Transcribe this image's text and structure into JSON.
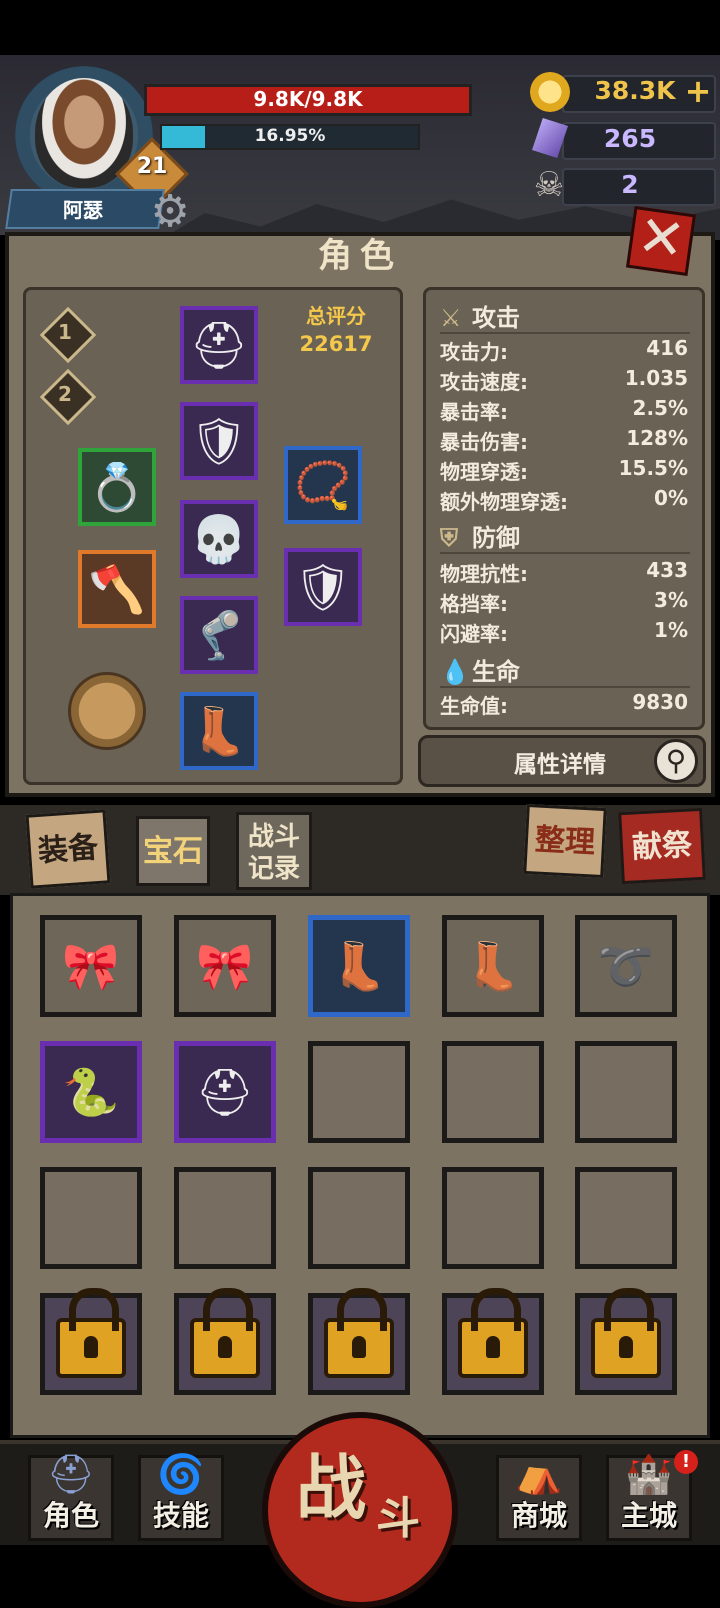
{
  "player": {
    "name": "阿瑟",
    "level": "21",
    "hp_text": "9.8K/9.8K",
    "exp_text": "16.95%",
    "exp_fraction": 0.1695
  },
  "currency": {
    "gold": "38.3K",
    "gold_plus": "+",
    "gems": "265",
    "souls": "2"
  },
  "panel": {
    "title": "角色",
    "close_glyph": "✕"
  },
  "equipment": {
    "score_label": "总评分",
    "score_value": "22617",
    "presets": [
      "1",
      "2"
    ],
    "slots": [
      {
        "name": "helmet",
        "rarity": "purple",
        "icon": "helmet-icon"
      },
      {
        "name": "chest-armor",
        "rarity": "purple",
        "icon": "armor-icon"
      },
      {
        "name": "belt",
        "rarity": "purple",
        "icon": "skull-belt-icon"
      },
      {
        "name": "leg-armor",
        "rarity": "purple",
        "icon": "greaves-icon"
      },
      {
        "name": "boots",
        "rarity": "blue",
        "icon": "boots-icon"
      },
      {
        "name": "ring",
        "rarity": "green",
        "icon": "ring-icon"
      },
      {
        "name": "weapon",
        "rarity": "orange",
        "icon": "axe-icon"
      },
      {
        "name": "necklace",
        "rarity": "blue",
        "icon": "necklace-icon"
      },
      {
        "name": "offhand",
        "rarity": "purple",
        "icon": "shield-icon"
      }
    ]
  },
  "stats": {
    "attack": {
      "title": "攻击",
      "rows": [
        {
          "label": "攻击力:",
          "value": "416"
        },
        {
          "label": "攻击速度:",
          "value": "1.035"
        },
        {
          "label": "暴击率:",
          "value": "2.5%"
        },
        {
          "label": "暴击伤害:",
          "value": "128%"
        },
        {
          "label": "物理穿透:",
          "value": "15.5%"
        },
        {
          "label": "额外物理穿透:",
          "value": "0%"
        }
      ]
    },
    "defense": {
      "title": "防御",
      "rows": [
        {
          "label": "物理抗性:",
          "value": "433"
        },
        {
          "label": "格挡率:",
          "value": "3%"
        },
        {
          "label": "闪避率:",
          "value": "1%"
        }
      ]
    },
    "life": {
      "title": "生命",
      "rows": [
        {
          "label": "生命值:",
          "value": "9830"
        }
      ]
    },
    "detail_button": "属性详情"
  },
  "tabs": {
    "equip": "装备",
    "gem": "宝石",
    "log_line1": "战斗",
    "log_line2": "记录",
    "sort": "整理",
    "sacrifice": "献祭"
  },
  "inventory": {
    "rows": [
      [
        {
          "type": "item",
          "rarity": "gray",
          "icon": "headband-icon",
          "glyph": "🎀"
        },
        {
          "type": "item",
          "rarity": "gray",
          "icon": "headband-icon",
          "glyph": "🎀"
        },
        {
          "type": "item",
          "rarity": "blue",
          "icon": "boots-icon",
          "glyph": "👢"
        },
        {
          "type": "item",
          "rarity": "gray",
          "icon": "boots-icon",
          "glyph": "👢"
        },
        {
          "type": "item",
          "rarity": "gray",
          "icon": "rope-belt-icon",
          "glyph": "➰"
        }
      ],
      [
        {
          "type": "item",
          "rarity": "purple",
          "icon": "serpent-staff-icon",
          "glyph": "🐍"
        },
        {
          "type": "item",
          "rarity": "purple",
          "icon": "knight-helmet-icon",
          "glyph": "⛑"
        },
        {
          "type": "empty"
        },
        {
          "type": "empty"
        },
        {
          "type": "empty"
        }
      ],
      [
        {
          "type": "empty"
        },
        {
          "type": "empty"
        },
        {
          "type": "empty"
        },
        {
          "type": "empty"
        },
        {
          "type": "empty"
        }
      ],
      [
        {
          "type": "locked"
        },
        {
          "type": "locked"
        },
        {
          "type": "locked"
        },
        {
          "type": "locked"
        },
        {
          "type": "locked"
        }
      ]
    ]
  },
  "nav": {
    "character": "角色",
    "skills": "技能",
    "battle_1": "战",
    "battle_2": "斗",
    "shop": "商城",
    "city": "主城",
    "city_badge": "!"
  },
  "colors": {
    "hp": "#b81e18",
    "exp": "#34b9d6",
    "gold": "#f0c44a",
    "score": "#f4c84a",
    "accent_red": "#b2291d"
  }
}
